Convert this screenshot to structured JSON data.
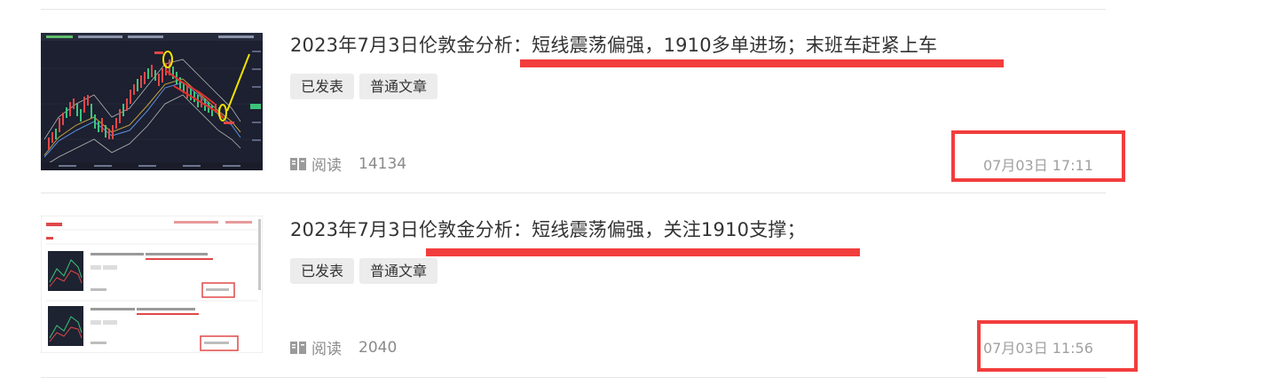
{
  "articles": [
    {
      "title": "2023年7月3日伦敦金分析：短线震荡偏强，1910多单进场；末班车赶紧上车",
      "tags": [
        "已发表",
        "普通文章"
      ],
      "read_label": "阅读",
      "read_count": "14134",
      "time": "07月03日 17:11",
      "thumb_type": "candlestick-chart"
    },
    {
      "title": "2023年7月3日伦敦金分析：短线震荡偏强，关注1910支撑；",
      "tags": [
        "已发表",
        "普通文章"
      ],
      "read_label": "阅读",
      "read_count": "2040",
      "time": "07月03日 11:56",
      "thumb_type": "article-list-screenshot"
    }
  ],
  "colors": {
    "highlight_red": "#f23d3d",
    "tag_bg": "#ececec",
    "meta_gray": "#8a8a8a"
  }
}
